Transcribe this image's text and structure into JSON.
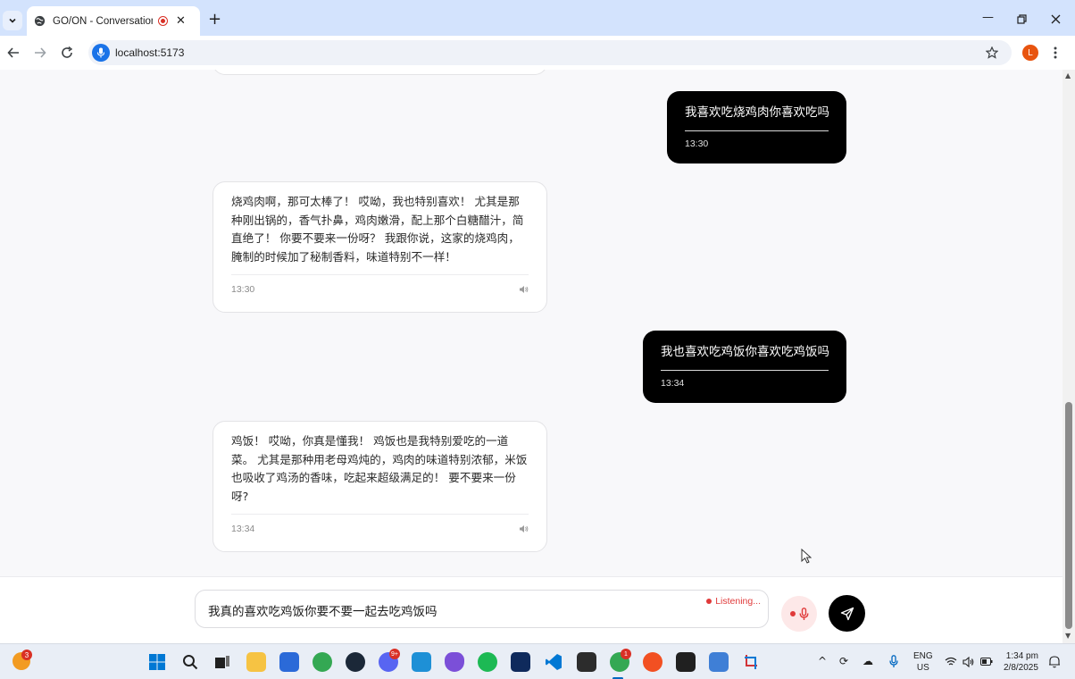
{
  "browser": {
    "tab_title": "GO/ON - Conversational La",
    "tab_close": "✕",
    "new_tab": "+",
    "url": "localhost:5173",
    "profile_initial": "L"
  },
  "messages": [
    {
      "role": "user",
      "text": "我喜欢吃烧鸡肉你喜欢吃吗",
      "time": "13:30"
    },
    {
      "role": "assistant",
      "text": "烧鸡肉啊，那可太棒了！ 哎呦，我也特别喜欢！ 尤其是那种刚出锅的，香气扑鼻，鸡肉嫩滑，配上那个白糖醋汁，简直绝了！ 你要不要来一份呀？ 我跟你说，这家的烧鸡肉，腌制的时候加了秘制香料，味道特别不一样！",
      "time": "13:30"
    },
    {
      "role": "user",
      "text": "我也喜欢吃鸡饭你喜欢吃鸡饭吗",
      "time": "13:34"
    },
    {
      "role": "assistant",
      "text": "鸡饭！ 哎呦，你真是懂我！ 鸡饭也是我特别爱吃的一道菜。 尤其是那种用老母鸡炖的，鸡肉的味道特别浓郁，米饭也吸收了鸡汤的香味，吃起来超级满足的！ 要不要来一份呀?",
      "time": "13:34"
    }
  ],
  "composer": {
    "input_value": "我真的喜欢吃鸡饭你要不要一起去吃鸡饭吗",
    "listening_label": "Listening..."
  },
  "taskbar": {
    "weather_badge": "3",
    "discord_badge": "9+",
    "chrome_badge": "1",
    "lang_line1": "ENG",
    "lang_line2": "US",
    "time": "1:34 pm",
    "date": "2/8/2025"
  },
  "colors": {
    "user_bubble": "#000000",
    "listening": "#e03a3a",
    "chrome_tabbar": "#d3e3fd"
  }
}
